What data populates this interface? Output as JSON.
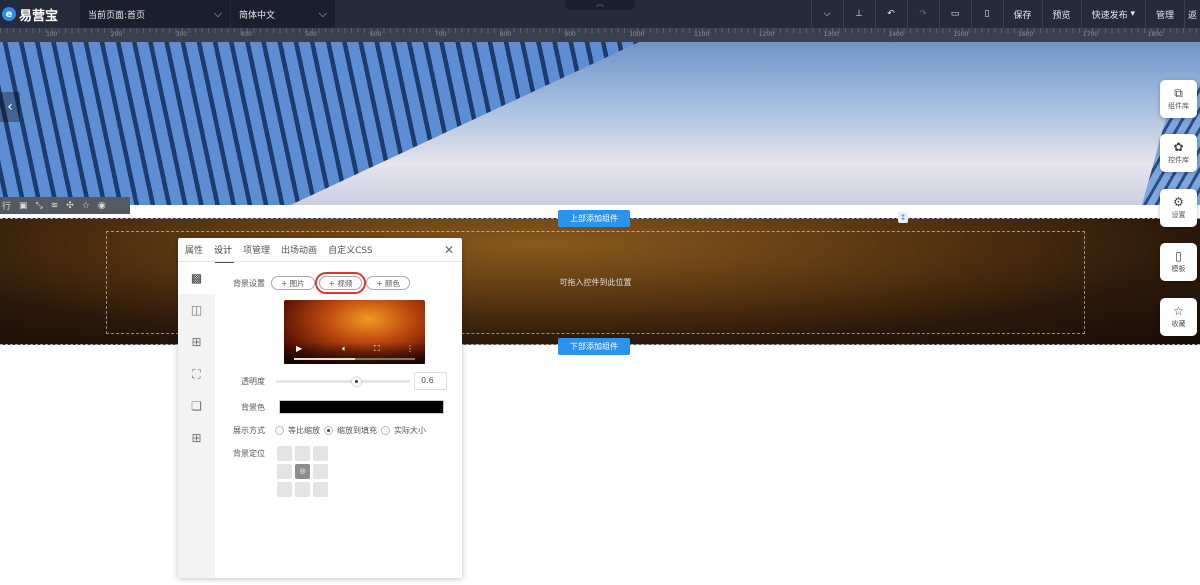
{
  "topbar": {
    "logo_text": "易营宝",
    "page_selector": "当前页面:首页",
    "language": "简体中文",
    "buttons": [
      "保存",
      "预览",
      "快速发布",
      "管理",
      "返"
    ]
  },
  "ruler": {
    "labels": [
      "100",
      "200",
      "300",
      "400",
      "500",
      "600",
      "700",
      "800",
      "900",
      "1000",
      "1100",
      "1200",
      "1300",
      "1400",
      "1500",
      "1600",
      "1700",
      "1800"
    ]
  },
  "canvas": {
    "top_add": "上部添加组件",
    "bottom_add": "下部添加组件",
    "drop_hint": "可拖入控件到此位置",
    "toolbar_first": "行"
  },
  "float_buttons": [
    {
      "label": "组件库",
      "icon": "⧉"
    },
    {
      "label": "控件库",
      "icon": "✿"
    },
    {
      "label": "设置",
      "icon": "⚙"
    },
    {
      "label": "模板",
      "icon": "▯"
    },
    {
      "label": "收藏",
      "icon": "☆"
    }
  ],
  "panel": {
    "tabs": [
      "属性",
      "设计",
      "项管理",
      "出场动画",
      "自定义CSS"
    ],
    "active_tab": "设计",
    "bg_label": "背景设置",
    "bg_buttons": [
      "+ 图片",
      "+ 视频",
      "+ 颜色"
    ],
    "opacity_label": "透明度",
    "opacity_value": "0.6",
    "opacity": 0.6,
    "bgcolor_label": "背景色",
    "bgcolor": "#000000",
    "display_label": "展示方式",
    "display_options": [
      "等比缩放",
      "缩放到填充",
      "实际大小"
    ],
    "display_selected": 1,
    "position_label": "背景定位",
    "video_progress": 0.5
  }
}
